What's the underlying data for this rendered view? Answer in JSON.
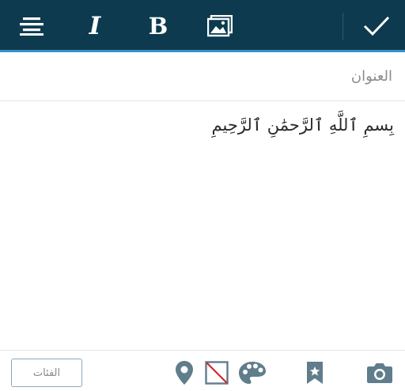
{
  "toolbar": {
    "italic_label": "I",
    "bold_label": "B",
    "icons": [
      "align-center-icon",
      "image-icon",
      "check-icon"
    ]
  },
  "editor": {
    "title_placeholder": "العنوان",
    "content": "بِسمِ ٱللَّهِ ٱلرَّحمَٰنِ ٱلرَّحِيمِ"
  },
  "bottom_bar": {
    "categories_label": "الفئات",
    "icons": [
      "location-pin-icon",
      "no-featured-image-icon",
      "palette-icon",
      "bookmark-star-icon",
      "camera-icon"
    ]
  },
  "colors": {
    "toolbar_bg": "#0d3a4e",
    "accent": "#3d8ec7",
    "icon_gray": "#607d8b"
  }
}
